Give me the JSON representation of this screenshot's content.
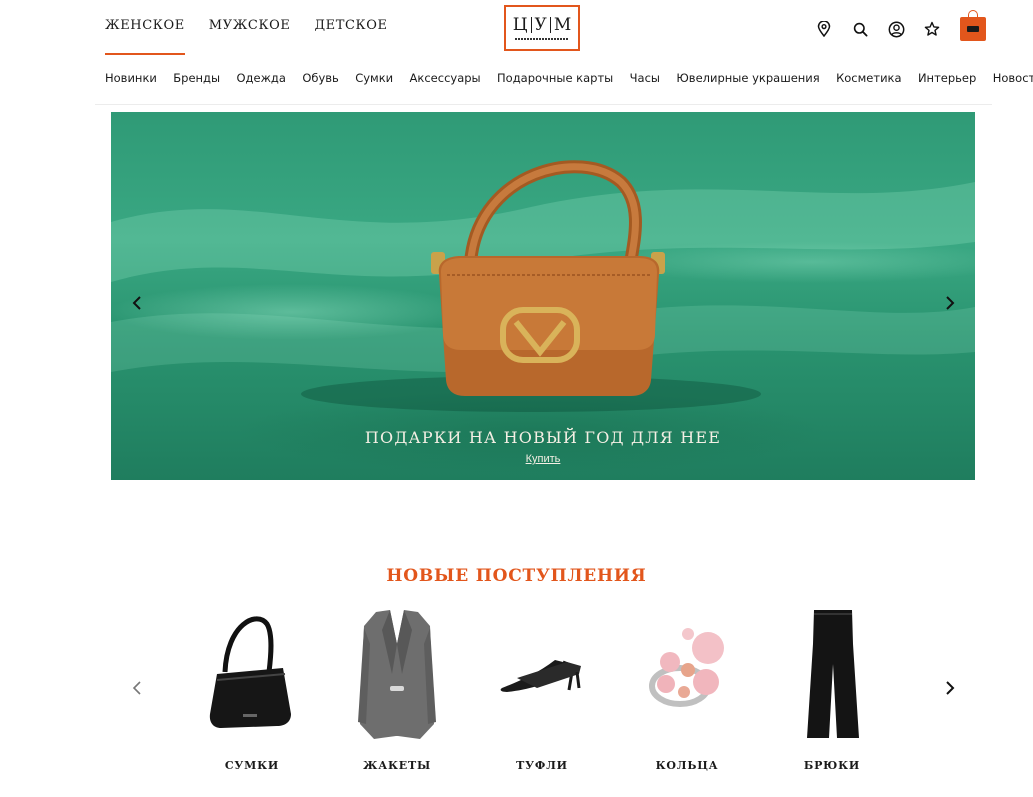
{
  "header": {
    "gender_tabs": [
      {
        "label": "ЖЕНСКОЕ",
        "active": true
      },
      {
        "label": "МУЖСКОЕ",
        "active": false
      },
      {
        "label": "ДЕТСКОЕ",
        "active": false
      }
    ],
    "logo": {
      "letters": [
        "Ц",
        "У",
        "М"
      ]
    },
    "icons": [
      "location-pin-icon",
      "search-icon",
      "account-icon",
      "favorites-star-icon",
      "shopping-bag-icon"
    ],
    "accent_color": "#e2561c"
  },
  "main_nav": {
    "items": [
      "Новинки",
      "Бренды",
      "Одежда",
      "Обувь",
      "Сумки",
      "Аксессуары",
      "Подарочные карты",
      "Часы",
      "Ювелирные украшения",
      "Косметика",
      "Интерьер",
      "Новости"
    ]
  },
  "hero": {
    "caption": "ПОДАРКИ НА НОВЫЙ ГОД ДЛЯ НЕЕ",
    "link": "Купить",
    "background_color": "#2f9a76"
  },
  "new_arrivals": {
    "title": "НОВЫЕ ПОСТУПЛЕНИЯ",
    "products": [
      {
        "label": "СУМКИ",
        "icon": "handbag-icon"
      },
      {
        "label": "ЖАКЕТЫ",
        "icon": "jacket-icon"
      },
      {
        "label": "ТУФЛИ",
        "icon": "shoe-icon"
      },
      {
        "label": "КОЛЬЦА",
        "icon": "ring-icon"
      },
      {
        "label": "БРЮКИ",
        "icon": "trousers-icon"
      }
    ]
  }
}
